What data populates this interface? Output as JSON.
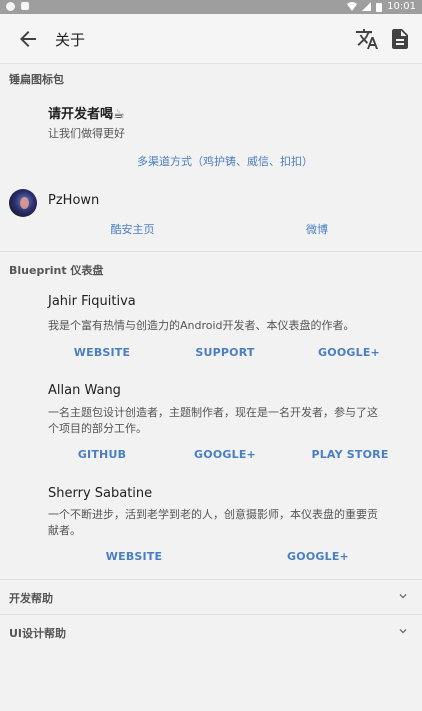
{
  "statusbar": {
    "time": "10:01"
  },
  "toolbar": {
    "title": "关于",
    "back_icon": "arrow-back-icon",
    "translate_icon": "translate-icon",
    "doc_icon": "document-icon"
  },
  "sections": {
    "icon_pack": {
      "header": "锤扁图标包",
      "donate_title": "请开发者喝☕",
      "donate_desc": "让我们做得更好",
      "donate_link": "多渠道方式（鸡护铸、威信、扣扣）",
      "author_name": "PzHown",
      "link1": "酷安主页",
      "link2": "微博"
    },
    "blueprint": {
      "header": "Blueprint 仪表盘",
      "people": [
        {
          "name": "Jahir Fiquitiva",
          "desc": "我是个富有热情与创造力的Android开发者、本仪表盘的作者。",
          "links": [
            "WEBSITE",
            "SUPPORT",
            "GOOGLE+"
          ]
        },
        {
          "name": "Allan Wang",
          "desc": "一名主题包设计创造者，主题制作者，现在是一名开发者，参与了这个项目的部分工作。",
          "links": [
            "GITHUB",
            "GOOGLE+",
            "PLAY STORE"
          ]
        },
        {
          "name": "Sherry Sabatine",
          "desc": "一个不断进步，活到老学到老的人，创意摄影师，本仪表盘的重要贡献者。",
          "links": [
            "WEBSITE",
            "GOOGLE+"
          ]
        }
      ]
    },
    "dev_help": {
      "label": "开发帮助"
    },
    "ui_help": {
      "label": "UI设计帮助"
    }
  },
  "colors": {
    "accent": "#4a7fc1",
    "background": "#f2f2f2"
  }
}
